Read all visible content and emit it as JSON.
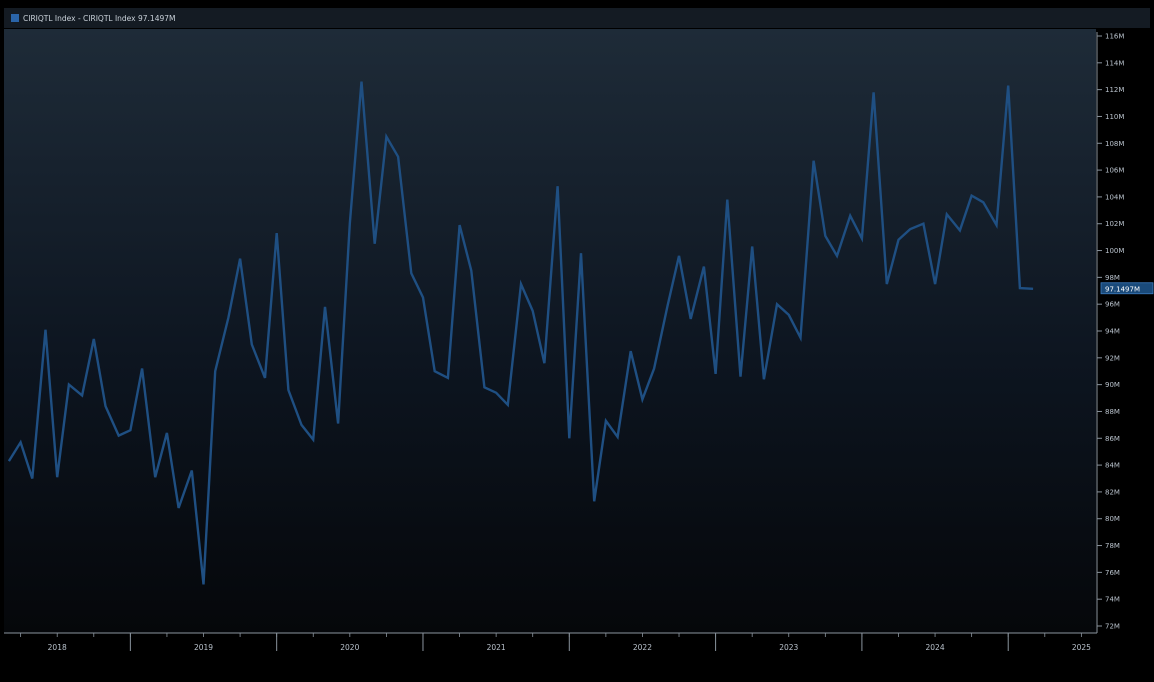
{
  "legend": {
    "text": "CIRIQTL Index - CIRIQTL Index  97.1497M"
  },
  "colors": {
    "series": "#1f4f82",
    "value_tag_bg": "#1a4a7a",
    "value_tag_border": "#3d7cc0",
    "axis": "#8a949e",
    "bg_top": "#1e2b38",
    "bg_bottom": "#05070a"
  },
  "chart_data": {
    "type": "line",
    "title": "",
    "xlabel": "",
    "ylabel": "",
    "ylim": [
      72,
      116
    ],
    "xlim": [
      2017.65,
      2025.1
    ],
    "y_ticks": [
      72,
      74,
      76,
      78,
      80,
      82,
      84,
      86,
      88,
      90,
      92,
      94,
      96,
      98,
      100,
      102,
      104,
      106,
      108,
      110,
      112,
      114,
      116
    ],
    "y_tick_labels": [
      "72M",
      "74M",
      "76M",
      "78M",
      "80M",
      "82M",
      "84M",
      "86M",
      "88M",
      "90M",
      "92M",
      "94M",
      "96M",
      "98M",
      "100M",
      "102M",
      "104M",
      "106M",
      "108M",
      "110M",
      "112M",
      "114M",
      "116M"
    ],
    "x_year_labels": [
      {
        "label": "2018",
        "x": 2018.0
      },
      {
        "label": "2019",
        "x": 2019.0
      },
      {
        "label": "2020",
        "x": 2020.0
      },
      {
        "label": "2021",
        "x": 2021.0
      },
      {
        "label": "2022",
        "x": 2022.0
      },
      {
        "label": "2023",
        "x": 2023.0
      },
      {
        "label": "2024",
        "x": 2024.0
      },
      {
        "label": "2025",
        "x": 2025.0
      }
    ],
    "x_major_ticks": [
      2017.5,
      2018.5,
      2019.5,
      2020.5,
      2021.5,
      2022.5,
      2023.5,
      2024.5,
      2025.5
    ],
    "last_value_label": "97.1497M",
    "last_value": 97.15,
    "series": [
      {
        "name": "CIRIQTL Index",
        "x": [
          2017.67,
          2017.75,
          2017.83,
          2017.92,
          2018.0,
          2018.08,
          2018.17,
          2018.25,
          2018.33,
          2018.42,
          2018.5,
          2018.58,
          2018.67,
          2018.75,
          2018.83,
          2018.92,
          2019.0,
          2019.08,
          2019.17,
          2019.25,
          2019.33,
          2019.42,
          2019.5,
          2019.58,
          2019.67,
          2019.75,
          2019.83,
          2019.92,
          2020.0,
          2020.08,
          2020.17,
          2020.25,
          2020.33,
          2020.42,
          2020.5,
          2020.58,
          2020.67,
          2020.75,
          2020.83,
          2020.92,
          2021.0,
          2021.08,
          2021.17,
          2021.25,
          2021.33,
          2021.42,
          2021.5,
          2021.58,
          2021.67,
          2021.75,
          2021.83,
          2021.92,
          2022.0,
          2022.08,
          2022.17,
          2022.25,
          2022.33,
          2022.42,
          2022.5,
          2022.58,
          2022.67,
          2022.75,
          2022.83,
          2022.92,
          2023.0,
          2023.08,
          2023.17,
          2023.25,
          2023.33,
          2023.42,
          2023.5,
          2023.58,
          2023.67,
          2023.75,
          2023.83,
          2023.92,
          2024.0,
          2024.08,
          2024.17,
          2024.25,
          2024.33,
          2024.42,
          2024.5,
          2024.58,
          2024.67
        ],
        "values": [
          84.3,
          85.7,
          83.0,
          94.1,
          83.1,
          90.0,
          89.2,
          93.4,
          88.4,
          86.2,
          86.6,
          91.2,
          83.1,
          86.4,
          80.8,
          83.6,
          75.1,
          91.0,
          95.0,
          99.4,
          93.0,
          90.5,
          101.3,
          89.6,
          87.0,
          85.9,
          95.8,
          87.1,
          102.0,
          112.6,
          100.5,
          108.5,
          107.0,
          98.3,
          96.5,
          91.0,
          90.5,
          101.9,
          98.5,
          89.8,
          89.4,
          88.5,
          97.5,
          95.5,
          91.6,
          104.8,
          86.0,
          99.8,
          81.3,
          87.3,
          86.1,
          92.5,
          88.9,
          91.2,
          95.8,
          99.6,
          94.9,
          98.8,
          90.8,
          103.8,
          90.6,
          100.3,
          90.4,
          96.0,
          95.2,
          93.5,
          106.7,
          101.1,
          99.6,
          102.6,
          100.9,
          111.8,
          97.5,
          100.8,
          101.6,
          102.0,
          97.5,
          102.7,
          101.5,
          104.1,
          103.6,
          101.9,
          112.3,
          97.2,
          97.15
        ]
      }
    ]
  }
}
